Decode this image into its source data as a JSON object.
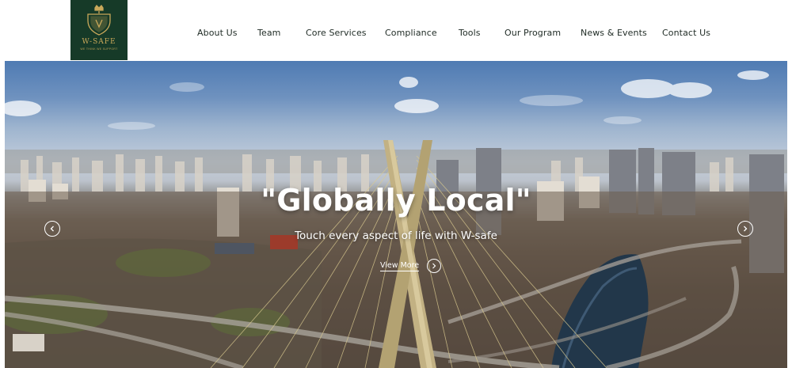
{
  "logo": {
    "name": "W-SAFE",
    "tagline": "WE THINK WE SUPPORT"
  },
  "nav": {
    "items": [
      {
        "label": "About Us"
      },
      {
        "label": "Team"
      },
      {
        "label": "Core Services"
      },
      {
        "label": "Compliance"
      },
      {
        "label": "Tools"
      },
      {
        "label": "Our Program"
      },
      {
        "label": "News & Events"
      },
      {
        "label": "Contact Us"
      }
    ]
  },
  "hero": {
    "title": "\"Globally Local\"",
    "subtitle": "Touch every aspect of life with W-safe",
    "cta_label": "View More"
  },
  "icons": {
    "prev": "chevron-left-icon",
    "next": "chevron-right-icon",
    "cta": "chevron-right-icon",
    "logo": "shield-crown-icon"
  },
  "colors": {
    "brand": "#163a28",
    "brand_accent": "#c9a85a",
    "nav_text": "#1e2a24",
    "hero_text": "#ffffff"
  }
}
